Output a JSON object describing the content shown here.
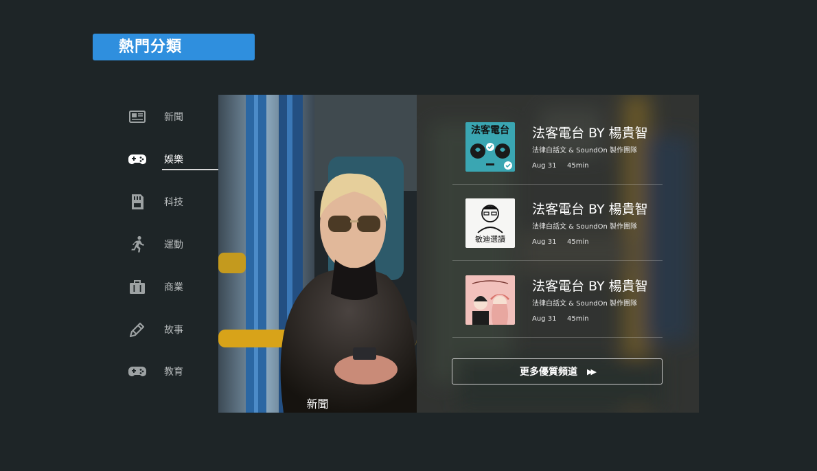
{
  "header": {
    "title": "熱門分類"
  },
  "categories": [
    {
      "label": "新聞",
      "icon": "newspaper-icon",
      "active": false
    },
    {
      "label": "娛樂",
      "icon": "gamepad-icon",
      "active": true
    },
    {
      "label": "科技",
      "icon": "sd-card-icon",
      "active": false
    },
    {
      "label": "運動",
      "icon": "running-icon",
      "active": false
    },
    {
      "label": "商業",
      "icon": "briefcase-icon",
      "active": false
    },
    {
      "label": "故事",
      "icon": "pencil-icon",
      "active": false
    },
    {
      "label": "教育",
      "icon": "gamepad-icon",
      "active": false
    }
  ],
  "feature": {
    "caption": "新聞"
  },
  "episodes": [
    {
      "title": "法客電台 BY 楊貴智",
      "subtitle": "法律白話文 & SoundOn 製作團隊",
      "date": "Aug 31",
      "duration": "45min",
      "cover_text": "法客電台"
    },
    {
      "title": "法客電台 BY 楊貴智",
      "subtitle": "法律白話文 & SoundOn 製作團隊",
      "date": "Aug 31",
      "duration": "45min",
      "cover_text": "敏迪選讀"
    },
    {
      "title": "法客電台 BY 楊貴智",
      "subtitle": "法律白話文 & SoundOn 製作團隊",
      "date": "Aug 31",
      "duration": "45min",
      "cover_text": ""
    }
  ],
  "more_button": {
    "label": "更多優質頻道",
    "icon": "fast-forward-icon"
  },
  "colors": {
    "accent": "#2f8fde",
    "background": "#1e2527"
  }
}
